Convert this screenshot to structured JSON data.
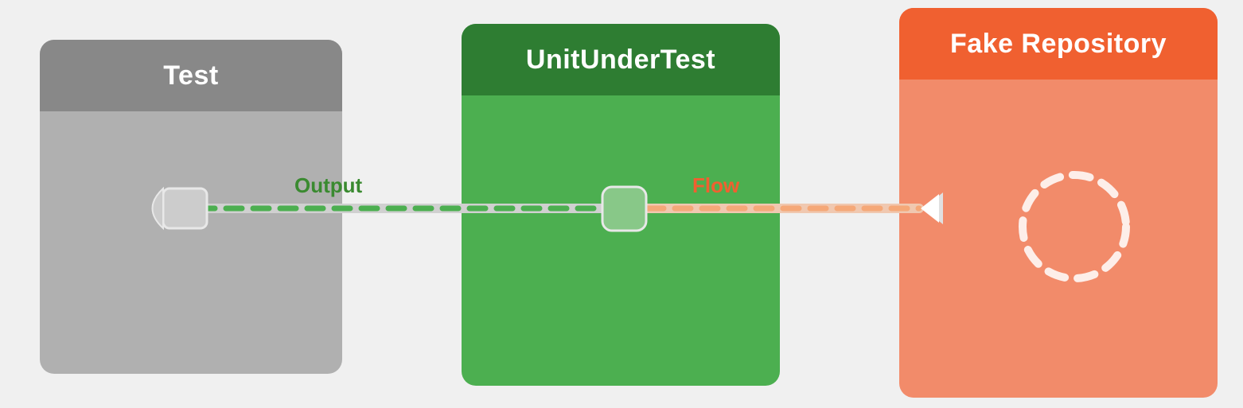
{
  "blocks": {
    "test": {
      "title": "Test",
      "header_color": "#888888",
      "body_color": "#b0b0b0"
    },
    "unit": {
      "title": "UnitUnderTest",
      "header_color": "#2e7d32",
      "body_color": "#4caf50"
    },
    "fake": {
      "title": "Fake Repository",
      "header_color": "#f06030",
      "body_color": "#f28b6a"
    }
  },
  "connections": {
    "output_label": "Output",
    "flow_label": "Flow"
  },
  "colors": {
    "output_green": "#3a8a30",
    "flow_orange": "#f06030",
    "connector_white": "#e0e0e0",
    "dashed_green": "#4caf50",
    "dashed_orange": "#f5a080"
  }
}
